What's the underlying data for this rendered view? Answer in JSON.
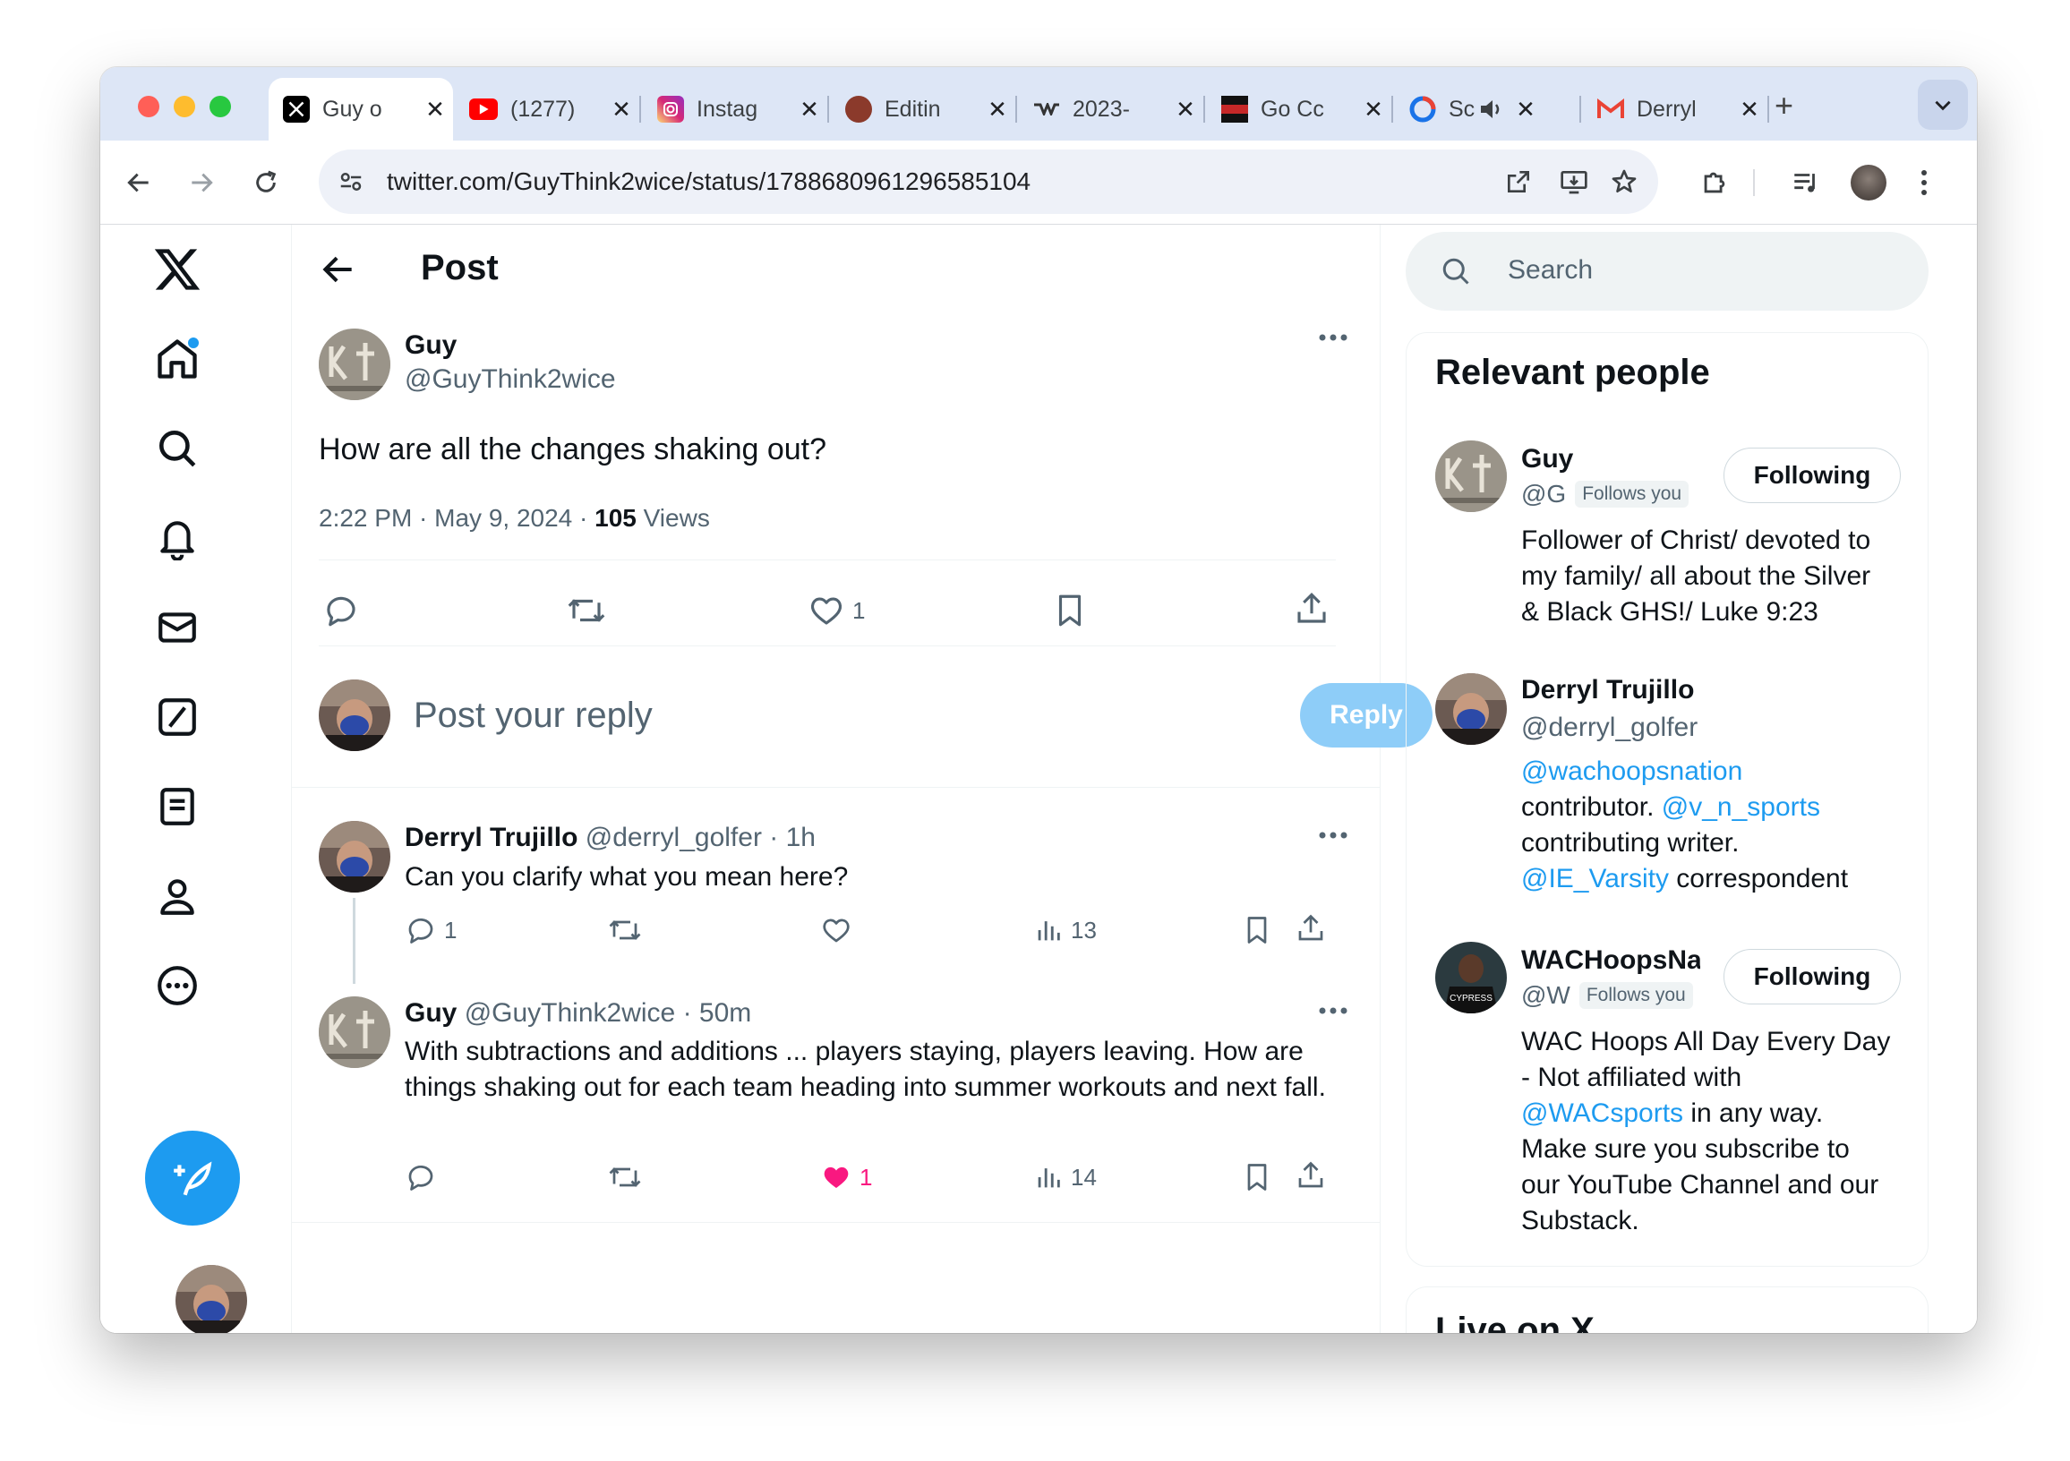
{
  "browser": {
    "tabs": [
      {
        "title": "Guy o",
        "favicon": "x-logo-icon",
        "active": true
      },
      {
        "title": "(1277)",
        "favicon": "youtube-icon"
      },
      {
        "title": "Instag",
        "favicon": "instagram-icon"
      },
      {
        "title": "Editin",
        "favicon": "editing-site-icon"
      },
      {
        "title": "2023-",
        "favicon": "wac-logo-icon"
      },
      {
        "title": "Go Cc",
        "favicon": "go-site-icon"
      },
      {
        "title": "Sc",
        "favicon": "sc-site-icon"
      },
      {
        "title": "Derryl",
        "favicon": "gmail-icon"
      }
    ],
    "close_glyph": "✕",
    "new_tab_glyph": "+",
    "url": "twitter.com/GuyThink2wice/status/1788680961296585104"
  },
  "main": {
    "header_title": "Post",
    "post": {
      "author_name": "Guy",
      "author_handle": "@GuyThink2wice",
      "text": "How are all the changes shaking out?",
      "timestamp": "2:22 PM · May 9, 2024 · ",
      "views_count": "105",
      "views_label": " Views",
      "like_count": "1"
    },
    "composer": {
      "placeholder": "Post your reply",
      "reply_label": "Reply"
    },
    "replies": [
      {
        "name": "Derryl Trujillo",
        "handle": "@derryl_golfer",
        "time": " · 1h",
        "text": "Can you clarify what you mean here?",
        "reply_count": "1",
        "views": "13"
      },
      {
        "name": "Guy",
        "handle": "@GuyThink2wice",
        "time": " · 50m",
        "text": "With subtractions and additions ... players staying, players leaving. How are things shaking out for each team heading into summer workouts and next fall.",
        "like_count": "1",
        "views": "14"
      }
    ]
  },
  "sidebar": {
    "search_placeholder": "Search",
    "relevant_title": "Relevant people",
    "people": [
      {
        "name": "Guy",
        "handle": "@G",
        "follows_you": "Follows you",
        "button": "Following",
        "bio_lines": [
          "Follower of Christ/ devoted to",
          "my family/ all about the Silver",
          "& Black GHS!/ Luke 9:23"
        ]
      },
      {
        "name": "Derryl Trujillo",
        "handle": "@derryl_golfer",
        "bio_link1": "@wachoopsnation",
        "bio_text1": "contributor. ",
        "bio_link2": "@v_n_sports",
        "bio_text2": "contributing writer.",
        "bio_link3": "@IE_Varsity",
        "bio_text3": " correspondent"
      },
      {
        "name": "WACHoopsNa",
        "handle": "@W",
        "follows_you": "Follows you",
        "button": "Following",
        "bio_line1": "WAC Hoops All Day Every Day",
        "bio_line2": "- Not affiliated with",
        "bio_link": "@WACsports",
        "bio_line3_rest": " in any way.",
        "bio_line4": "Make sure you subscribe to",
        "bio_line5": "our YouTube Channel and our",
        "bio_line6": "Substack."
      }
    ],
    "live_title": "Live on X"
  },
  "colors": {
    "accent": "#1d9bf0",
    "like": "#f91880",
    "muted": "#536471",
    "reply_disabled": "#8ecdf8"
  }
}
